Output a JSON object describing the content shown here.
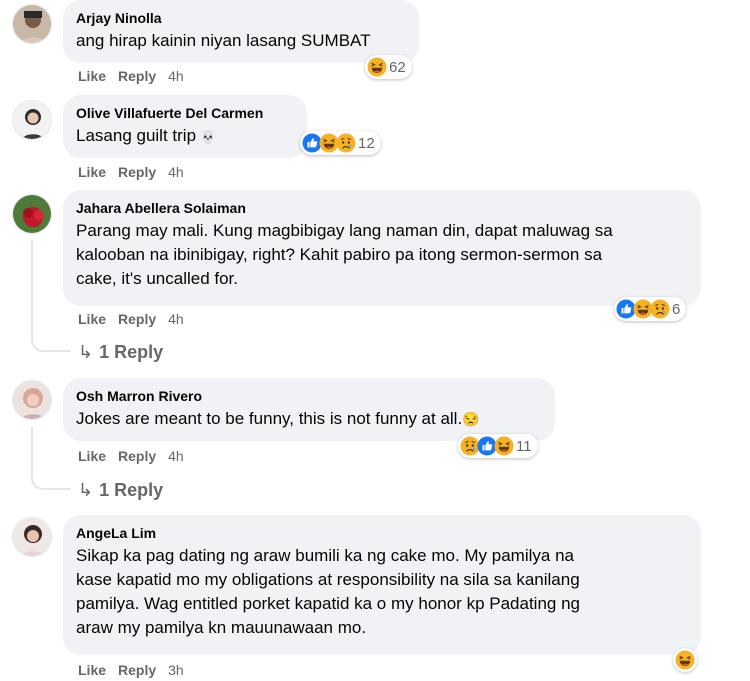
{
  "comments": [
    {
      "author": "Arjay Ninolla",
      "lines": [
        "ang hirap kainin niyan lasang SUMBAT"
      ],
      "actions": {
        "like": "Like",
        "reply": "Reply",
        "time": "4h"
      },
      "reaction_icons": [
        "haha"
      ],
      "reaction_count": "62"
    },
    {
      "author": "Olive Villafuerte Del Carmen",
      "lines": [
        "Lasang guilt trip"
      ],
      "inline_emoji": "skull-emoji",
      "actions": {
        "like": "Like",
        "reply": "Reply",
        "time": "4h"
      },
      "reaction_icons": [
        "like",
        "haha",
        "sad"
      ],
      "reaction_count": "12"
    },
    {
      "author": "Jahara Abellera Solaiman",
      "lines": [
        "Parang may mali. Kung magbibigay lang naman din, dapat maluwag sa",
        "kalooban na ibinibigay, right? Kahit pabiro pa itong sermon-sermon sa",
        "cake, it's uncalled for."
      ],
      "actions": {
        "like": "Like",
        "reply": "Reply",
        "time": "4h"
      },
      "reaction_icons": [
        "like",
        "haha",
        "sad"
      ],
      "reaction_count": "6",
      "replies_link": "1 Reply"
    },
    {
      "author": "Osh Marron Rivero",
      "lines": [
        "Jokes are meant to be funny, this is not funny at all."
      ],
      "inline_emoji": "unamused-emoji",
      "actions": {
        "like": "Like",
        "reply": "Reply",
        "time": "4h"
      },
      "reaction_icons": [
        "sad",
        "like",
        "haha"
      ],
      "reaction_count": "11",
      "replies_link": "1 Reply"
    },
    {
      "author": "AngeLa Lim",
      "lines": [
        "Sikap ka pag dating ng araw bumili ka ng cake mo. My pamilya na",
        "kase kapatid mo my obligations at responsibility na sila sa kanilang",
        "pamilya. Wag entitled porket kapatid ka o my honor kp Padating ng",
        "araw my pamilya kn mauunawaan mo."
      ],
      "actions": {
        "like": "Like",
        "reply": "Reply",
        "time": "3h"
      },
      "reaction_icons": [
        "haha"
      ],
      "reaction_count": ""
    }
  ],
  "colors": {
    "bubble": "#f0f2f5",
    "secondary_text": "#65676b",
    "like_blue": "#1877f2",
    "emoji_yellow": "#f7b125"
  }
}
